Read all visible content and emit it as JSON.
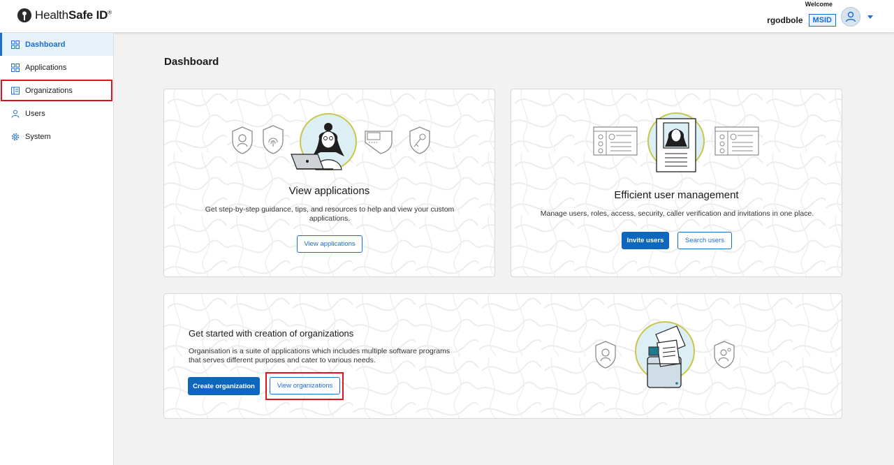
{
  "header": {
    "brand_normal": "Health",
    "brand_bold": "Safe ID",
    "brand_mark": "®",
    "welcome": "Welcome",
    "username": "rgodbole",
    "badge": "MSID"
  },
  "sidebar": {
    "items": [
      {
        "label": "Dashboard",
        "icon": "dashboard-icon"
      },
      {
        "label": "Applications",
        "icon": "applications-icon"
      },
      {
        "label": "Organizations",
        "icon": "organizations-icon"
      },
      {
        "label": "Users",
        "icon": "user-icon"
      },
      {
        "label": "System",
        "icon": "gear-icon"
      }
    ]
  },
  "main": {
    "title": "Dashboard",
    "cards": {
      "applications": {
        "title": "View applications",
        "description": "Get step-by-step guidance, tips, and resources to help and view your custom applications.",
        "button": "View applications"
      },
      "users": {
        "title": "Efficient user management",
        "description": "Manage users, roles, access, security, caller verification and invitations in one place.",
        "primary_button": "Invite users",
        "secondary_button": "Search users"
      },
      "organizations": {
        "title": "Get started with creation of organizations",
        "description": "Organisation is a suite of applications which includes multiple software programs that serves different purposes and cater to various needs.",
        "primary_button": "Create organization",
        "secondary_button": "View organizations"
      }
    }
  },
  "colors": {
    "accent": "#196ecf",
    "primary_button": "#0f67bd",
    "highlight": "#e0121c",
    "illustration_ring": "#c9c64a"
  }
}
